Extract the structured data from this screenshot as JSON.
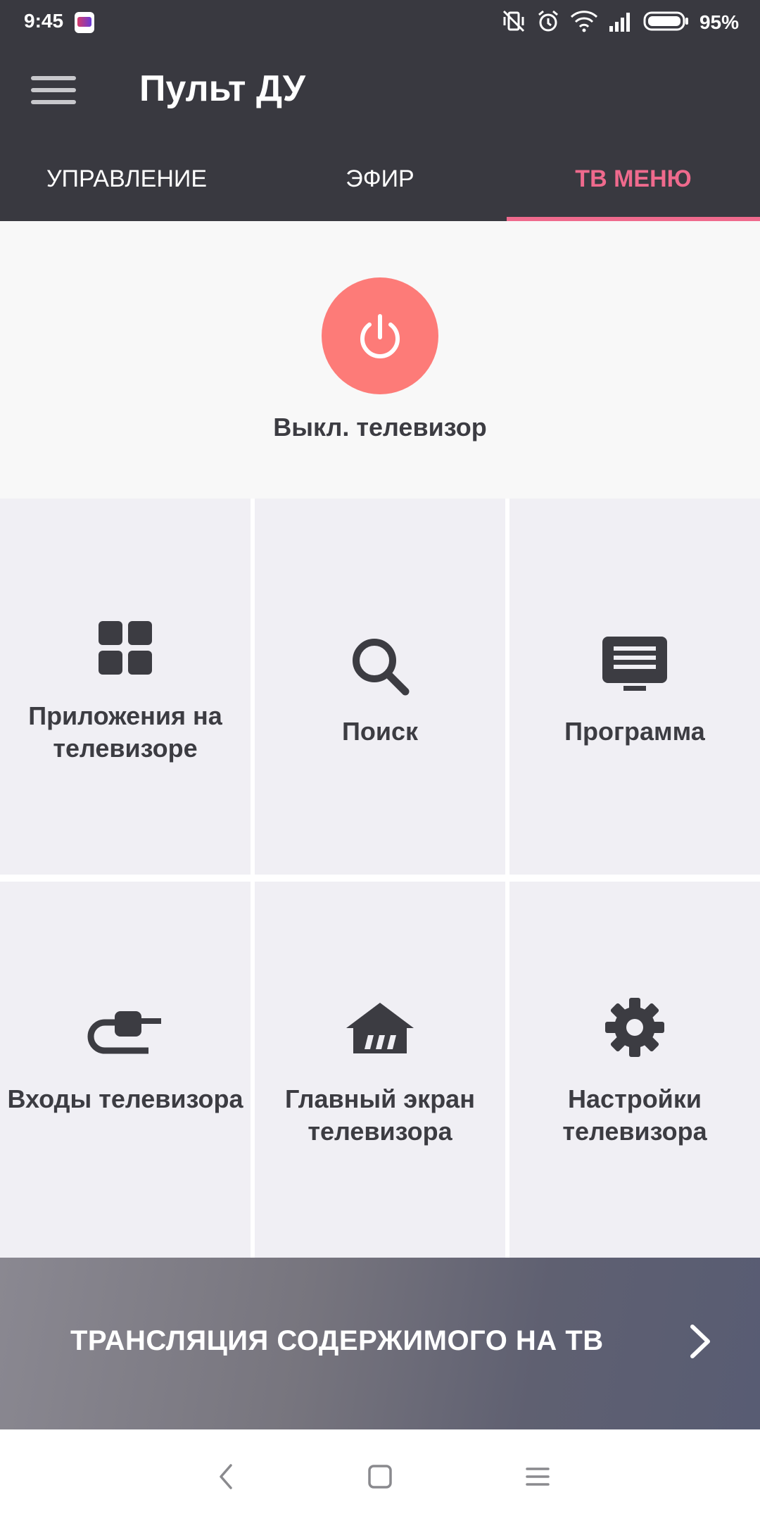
{
  "status_bar": {
    "time": "9:45",
    "battery_percent": "95%"
  },
  "toolbar": {
    "title": "Пульт ДУ"
  },
  "tabs": [
    {
      "label": "УПРАВЛЕНИЕ",
      "active": false
    },
    {
      "label": "ЭФИР",
      "active": false
    },
    {
      "label": "ТВ МЕНЮ",
      "active": true
    }
  ],
  "power": {
    "label": "Выкл. телевизор"
  },
  "grid": [
    {
      "label": "Приложения на телевизоре",
      "icon": "apps-grid-icon"
    },
    {
      "label": "Поиск",
      "icon": "search-icon"
    },
    {
      "label": "Программа",
      "icon": "tv-guide-icon"
    },
    {
      "label": "Входы телевизора",
      "icon": "input-plug-icon"
    },
    {
      "label": "Главный экран телевизора",
      "icon": "home-icon"
    },
    {
      "label": "Настройки телевизора",
      "icon": "gear-icon"
    }
  ],
  "cast_banner": {
    "label": "ТРАНСЛЯЦИЯ СОДЕРЖИМОГО НА ТВ"
  },
  "colors": {
    "appbar": "#393940",
    "accent": "#ef6a8d",
    "power": "#fd7b78",
    "tile": "#f0eff4",
    "text_dark": "#3c3c42"
  }
}
